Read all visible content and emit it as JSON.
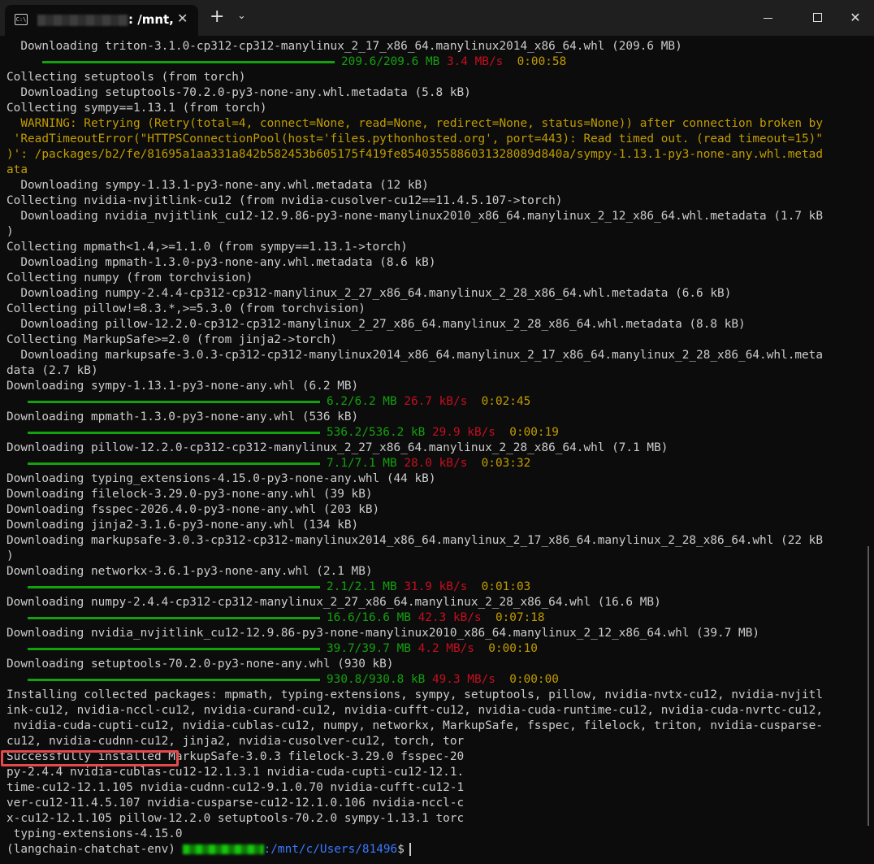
{
  "window": {
    "tab_title": ": /mnt,",
    "tab_close": "✕",
    "new_tab": "+",
    "dropdown": "⌄",
    "close_glyph": "✕"
  },
  "colors": {
    "green": "#13a10e",
    "red": "#c50f1f",
    "yellow": "#c19c00",
    "blue": "#3b78ff",
    "text": "#cccccc",
    "background": "#0c0c0c"
  },
  "terminal": {
    "lines": [
      {
        "type": "text",
        "text": "  Downloading triton-3.1.0-cp312-cp312-manylinux_2_17_x86_64.manylinux2014_x86_64.whl (209.6 MB)"
      },
      {
        "type": "progress",
        "indent": 44,
        "bar": 360,
        "size": "209.6/209.6 MB",
        "speed": "3.4 MB/s",
        "time": "0:00:58"
      },
      {
        "type": "text",
        "text": "Collecting setuptools (from torch)"
      },
      {
        "type": "text",
        "text": "  Downloading setuptools-70.2.0-py3-none-any.whl.metadata (5.8 kB)"
      },
      {
        "type": "text",
        "text": "Collecting sympy==1.13.1 (from torch)"
      },
      {
        "type": "warn",
        "text": "  WARNING: Retrying (Retry(total=4, connect=None, read=None, redirect=None, status=None)) after connection broken by"
      },
      {
        "type": "warn",
        "text": " 'ReadTimeoutError(\"HTTPSConnectionPool(host='files.pythonhosted.org', port=443): Read timed out. (read timeout=15)\""
      },
      {
        "type": "warn",
        "text": ")': /packages/b2/fe/81695a1aa331a842b582453b605175f419fe8540355886031328089d840a/sympy-1.13.1-py3-none-any.whl.metad"
      },
      {
        "type": "warn",
        "text": "ata"
      },
      {
        "type": "text",
        "text": "  Downloading sympy-1.13.1-py3-none-any.whl.metadata (12 kB)"
      },
      {
        "type": "text",
        "text": "Collecting nvidia-nvjitlink-cu12 (from nvidia-cusolver-cu12==11.4.5.107->torch)"
      },
      {
        "type": "text",
        "text": "  Downloading nvidia_nvjitlink_cu12-12.9.86-py3-none-manylinux2010_x86_64.manylinux_2_12_x86_64.whl.metadata (1.7 kB"
      },
      {
        "type": "text",
        "text": ")"
      },
      {
        "type": "text",
        "text": "Collecting mpmath<1.4,>=1.1.0 (from sympy==1.13.1->torch)"
      },
      {
        "type": "text",
        "text": "  Downloading mpmath-1.3.0-py3-none-any.whl.metadata (8.6 kB)"
      },
      {
        "type": "text",
        "text": "Collecting numpy (from torchvision)"
      },
      {
        "type": "text",
        "text": "  Downloading numpy-2.4.4-cp312-cp312-manylinux_2_27_x86_64.manylinux_2_28_x86_64.whl.metadata (6.6 kB)"
      },
      {
        "type": "text",
        "text": "Collecting pillow!=8.3.*,>=5.3.0 (from torchvision)"
      },
      {
        "type": "text",
        "text": "  Downloading pillow-12.2.0-cp312-cp312-manylinux_2_27_x86_64.manylinux_2_28_x86_64.whl.metadata (8.8 kB)"
      },
      {
        "type": "text",
        "text": "Collecting MarkupSafe>=2.0 (from jinja2->torch)"
      },
      {
        "type": "text",
        "text": "  Downloading markupsafe-3.0.3-cp312-cp312-manylinux2014_x86_64.manylinux_2_17_x86_64.manylinux_2_28_x86_64.whl.meta"
      },
      {
        "type": "text",
        "text": "data (2.7 kB)"
      },
      {
        "type": "text",
        "text": "Downloading sympy-1.13.1-py3-none-any.whl (6.2 MB)"
      },
      {
        "type": "progress",
        "indent": 26,
        "bar": 360,
        "size": "6.2/6.2 MB",
        "speed": "26.7 kB/s",
        "time": "0:02:45"
      },
      {
        "type": "text",
        "text": "Downloading mpmath-1.3.0-py3-none-any.whl (536 kB)"
      },
      {
        "type": "progress",
        "indent": 26,
        "bar": 360,
        "size": "536.2/536.2 kB",
        "speed": "29.9 kB/s",
        "time": "0:00:19"
      },
      {
        "type": "text",
        "text": "Downloading pillow-12.2.0-cp312-cp312-manylinux_2_27_x86_64.manylinux_2_28_x86_64.whl (7.1 MB)"
      },
      {
        "type": "progress",
        "indent": 26,
        "bar": 360,
        "size": "7.1/7.1 MB",
        "speed": "28.0 kB/s",
        "time": "0:03:32"
      },
      {
        "type": "text",
        "text": "Downloading typing_extensions-4.15.0-py3-none-any.whl (44 kB)"
      },
      {
        "type": "text",
        "text": "Downloading filelock-3.29.0-py3-none-any.whl (39 kB)"
      },
      {
        "type": "text",
        "text": "Downloading fsspec-2026.4.0-py3-none-any.whl (203 kB)"
      },
      {
        "type": "text",
        "text": "Downloading jinja2-3.1.6-py3-none-any.whl (134 kB)"
      },
      {
        "type": "text",
        "text": "Downloading markupsafe-3.0.3-cp312-cp312-manylinux2014_x86_64.manylinux_2_17_x86_64.manylinux_2_28_x86_64.whl (22 kB"
      },
      {
        "type": "text",
        "text": ")"
      },
      {
        "type": "text",
        "text": "Downloading networkx-3.6.1-py3-none-any.whl (2.1 MB)"
      },
      {
        "type": "progress",
        "indent": 26,
        "bar": 360,
        "size": "2.1/2.1 MB",
        "speed": "31.9 kB/s",
        "time": "0:01:03"
      },
      {
        "type": "text",
        "text": "Downloading numpy-2.4.4-cp312-cp312-manylinux_2_27_x86_64.manylinux_2_28_x86_64.whl (16.6 MB)"
      },
      {
        "type": "progress",
        "indent": 26,
        "bar": 360,
        "size": "16.6/16.6 MB",
        "speed": "42.3 kB/s",
        "time": "0:07:18"
      },
      {
        "type": "text",
        "text": "Downloading nvidia_nvjitlink_cu12-12.9.86-py3-none-manylinux2010_x86_64.manylinux_2_12_x86_64.whl (39.7 MB)"
      },
      {
        "type": "progress",
        "indent": 26,
        "bar": 360,
        "size": "39.7/39.7 MB",
        "speed": "4.2 MB/s",
        "time": "0:00:10"
      },
      {
        "type": "text",
        "text": "Downloading setuptools-70.2.0-py3-none-any.whl (930 kB)"
      },
      {
        "type": "progress",
        "indent": 26,
        "bar": 360,
        "size": "930.8/930.8 kB",
        "speed": "49.3 MB/s",
        "time": "0:00:00"
      },
      {
        "type": "text",
        "text": "Installing collected packages: mpmath, typing-extensions, sympy, setuptools, pillow, nvidia-nvtx-cu12, nvidia-nvjitl"
      },
      {
        "type": "text",
        "text": "ink-cu12, nvidia-nccl-cu12, nvidia-curand-cu12, nvidia-cufft-cu12, nvidia-cuda-runtime-cu12, nvidia-cuda-nvrtc-cu12,"
      },
      {
        "type": "text",
        "text": " nvidia-cuda-cupti-cu12, nvidia-cublas-cu12, numpy, networkx, MarkupSafe, fsspec, filelock, triton, nvidia-cusparse-"
      },
      {
        "type": "text",
        "text": "cu12, nvidia-cudnn-cu12, jinja2, nvidia-cusolver-cu12, torch, tor"
      },
      {
        "type": "text",
        "text": "Successfully installed MarkupSafe-3.0.3 filelock-3.29.0 fsspec-20"
      },
      {
        "type": "text",
        "text": "py-2.4.4 nvidia-cublas-cu12-12.1.3.1 nvidia-cuda-cupti-cu12-12.1."
      },
      {
        "type": "text",
        "text": "time-cu12-12.1.105 nvidia-cudnn-cu12-9.1.0.70 nvidia-cufft-cu12-1"
      },
      {
        "type": "text",
        "text": "ver-cu12-11.4.5.107 nvidia-cusparse-cu12-12.1.0.106 nvidia-nccl-c"
      },
      {
        "type": "text",
        "text": "x-cu12-12.1.105 pillow-12.2.0 setuptools-70.2.0 sympy-1.13.1 torc"
      },
      {
        "type": "text",
        "text": " typing-extensions-4.15.0"
      }
    ],
    "prompt": {
      "env": "(langchain-chatchat-env) ",
      "path": ":/mnt/c/Users/81496",
      "symbol": "$"
    }
  }
}
